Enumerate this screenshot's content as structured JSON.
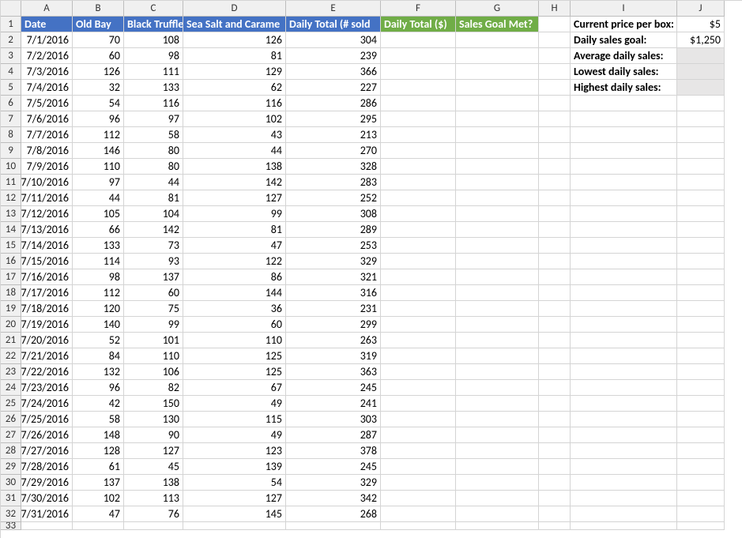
{
  "columns": [
    "A",
    "B",
    "C",
    "D",
    "E",
    "F",
    "G",
    "H",
    "I",
    "J"
  ],
  "headers": {
    "A": "Date",
    "B": "Old Bay",
    "C": "Black Truffle",
    "D": "Sea Salt and Carame",
    "E": "Daily Total (# sold",
    "F": "Daily Total ($)",
    "G": "Sales Goal Met?"
  },
  "rows": [
    {
      "date": "7/1/2016",
      "b": 70,
      "c": 108,
      "d": 126,
      "e": 304
    },
    {
      "date": "7/2/2016",
      "b": 60,
      "c": 98,
      "d": 81,
      "e": 239
    },
    {
      "date": "7/3/2016",
      "b": 126,
      "c": 111,
      "d": 129,
      "e": 366
    },
    {
      "date": "7/4/2016",
      "b": 32,
      "c": 133,
      "d": 62,
      "e": 227
    },
    {
      "date": "7/5/2016",
      "b": 54,
      "c": 116,
      "d": 116,
      "e": 286
    },
    {
      "date": "7/6/2016",
      "b": 96,
      "c": 97,
      "d": 102,
      "e": 295
    },
    {
      "date": "7/7/2016",
      "b": 112,
      "c": 58,
      "d": 43,
      "e": 213
    },
    {
      "date": "7/8/2016",
      "b": 146,
      "c": 80,
      "d": 44,
      "e": 270
    },
    {
      "date": "7/9/2016",
      "b": 110,
      "c": 80,
      "d": 138,
      "e": 328
    },
    {
      "date": "7/10/2016",
      "b": 97,
      "c": 44,
      "d": 142,
      "e": 283
    },
    {
      "date": "7/11/2016",
      "b": 44,
      "c": 81,
      "d": 127,
      "e": 252
    },
    {
      "date": "7/12/2016",
      "b": 105,
      "c": 104,
      "d": 99,
      "e": 308
    },
    {
      "date": "7/13/2016",
      "b": 66,
      "c": 142,
      "d": 81,
      "e": 289
    },
    {
      "date": "7/14/2016",
      "b": 133,
      "c": 73,
      "d": 47,
      "e": 253
    },
    {
      "date": "7/15/2016",
      "b": 114,
      "c": 93,
      "d": 122,
      "e": 329
    },
    {
      "date": "7/16/2016",
      "b": 98,
      "c": 137,
      "d": 86,
      "e": 321
    },
    {
      "date": "7/17/2016",
      "b": 112,
      "c": 60,
      "d": 144,
      "e": 316
    },
    {
      "date": "7/18/2016",
      "b": 120,
      "c": 75,
      "d": 36,
      "e": 231
    },
    {
      "date": "7/19/2016",
      "b": 140,
      "c": 99,
      "d": 60,
      "e": 299
    },
    {
      "date": "7/20/2016",
      "b": 52,
      "c": 101,
      "d": 110,
      "e": 263
    },
    {
      "date": "7/21/2016",
      "b": 84,
      "c": 110,
      "d": 125,
      "e": 319
    },
    {
      "date": "7/22/2016",
      "b": 132,
      "c": 106,
      "d": 125,
      "e": 363
    },
    {
      "date": "7/23/2016",
      "b": 96,
      "c": 82,
      "d": 67,
      "e": 245
    },
    {
      "date": "7/24/2016",
      "b": 42,
      "c": 150,
      "d": 49,
      "e": 241
    },
    {
      "date": "7/25/2016",
      "b": 58,
      "c": 130,
      "d": 115,
      "e": 303
    },
    {
      "date": "7/26/2016",
      "b": 148,
      "c": 90,
      "d": 49,
      "e": 287
    },
    {
      "date": "7/27/2016",
      "b": 128,
      "c": 127,
      "d": 123,
      "e": 378
    },
    {
      "date": "7/28/2016",
      "b": 61,
      "c": 45,
      "d": 139,
      "e": 245
    },
    {
      "date": "7/29/2016",
      "b": 137,
      "c": 138,
      "d": 54,
      "e": 329
    },
    {
      "date": "7/30/2016",
      "b": 102,
      "c": 113,
      "d": 127,
      "e": 342
    },
    {
      "date": "7/31/2016",
      "b": 47,
      "c": 76,
      "d": 145,
      "e": 268
    }
  ],
  "side": {
    "price_label": "Current price per box:",
    "price_value": "$5",
    "goal_label": "Daily sales goal:",
    "goal_value": "$1,250",
    "avg_label": "Average daily sales:",
    "low_label": "Lowest daily sales:",
    "high_label": "Highest daily sales:"
  }
}
